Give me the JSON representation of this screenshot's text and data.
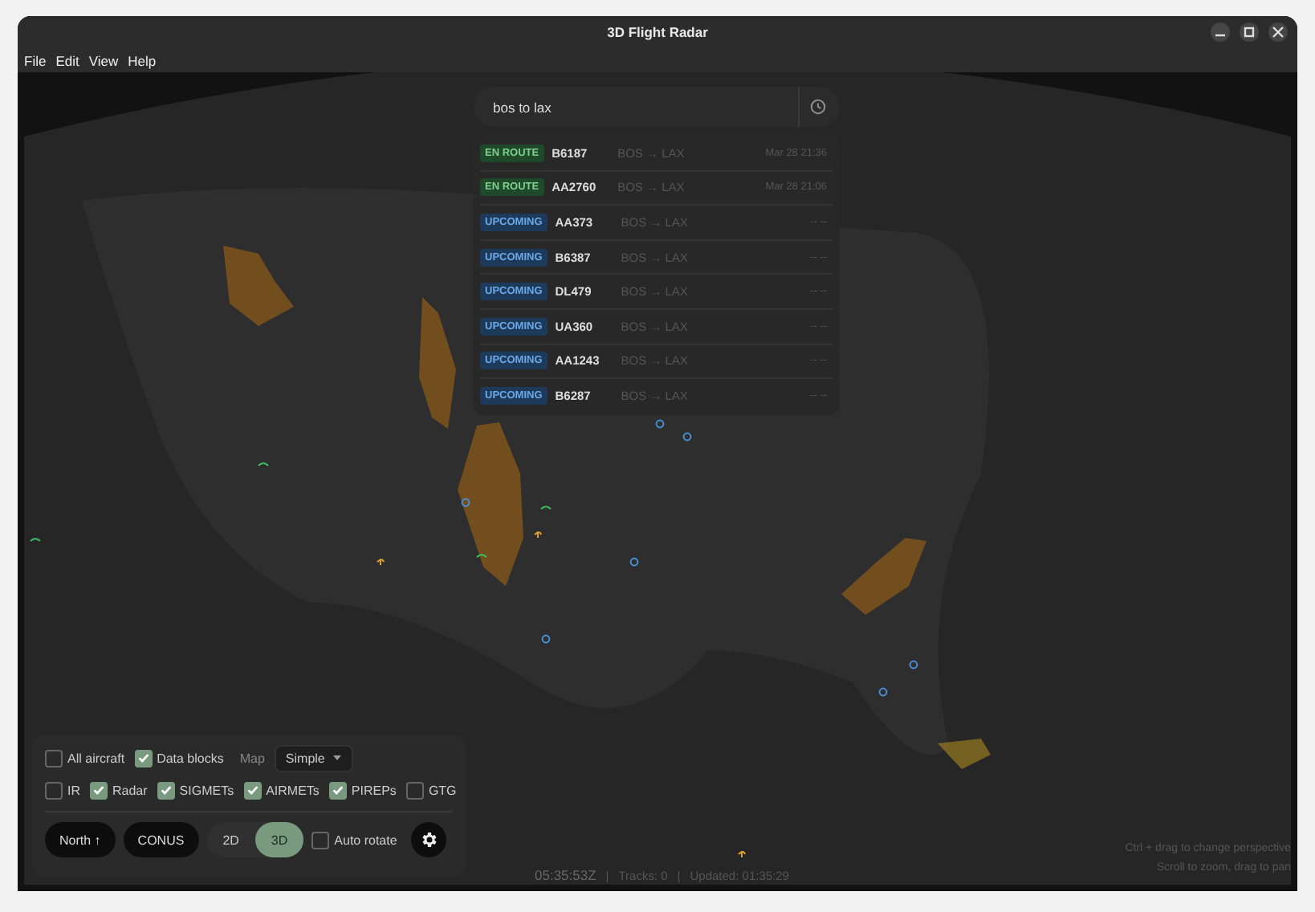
{
  "window": {
    "title": "3D Flight Radar"
  },
  "menu": [
    "File",
    "Edit",
    "View",
    "Help"
  ],
  "search": {
    "value": "bos to lax"
  },
  "results": [
    {
      "kind": "en_route",
      "status": "EN ROUTE",
      "flight": "B6187",
      "route": "BOS → LAX",
      "time": "Mar 28 21:36"
    },
    {
      "kind": "en_route",
      "status": "EN ROUTE",
      "flight": "AA2760",
      "route": "BOS → LAX",
      "time": "Mar 28 21:06"
    },
    {
      "kind": "upcoming",
      "status": "UPCOMING",
      "flight": "AA373",
      "route": "BOS → LAX",
      "time": "-- --"
    },
    {
      "kind": "upcoming",
      "status": "UPCOMING",
      "flight": "B6387",
      "route": "BOS → LAX",
      "time": "-- --"
    },
    {
      "kind": "upcoming",
      "status": "UPCOMING",
      "flight": "DL479",
      "route": "BOS → LAX",
      "time": "-- --"
    },
    {
      "kind": "upcoming",
      "status": "UPCOMING",
      "flight": "UA360",
      "route": "BOS → LAX",
      "time": "-- --"
    },
    {
      "kind": "upcoming",
      "status": "UPCOMING",
      "flight": "AA1243",
      "route": "BOS → LAX",
      "time": "-- --"
    },
    {
      "kind": "upcoming",
      "status": "UPCOMING",
      "flight": "B6287",
      "route": "BOS → LAX",
      "time": "-- --"
    }
  ],
  "controls": {
    "row_1": [
      {
        "label": "All aircraft",
        "checked": false
      },
      {
        "label": "Data blocks",
        "checked": true
      }
    ],
    "map_select": {
      "label": "Map",
      "value": "Simple"
    },
    "row_2": [
      {
        "label": "IR",
        "checked": false
      },
      {
        "label": "Radar",
        "checked": true
      },
      {
        "label": "SIGMETs",
        "checked": true
      },
      {
        "label": "AIRMETs",
        "checked": true
      },
      {
        "label": "PIREPs",
        "checked": true
      },
      {
        "label": "GTG",
        "checked": false
      }
    ],
    "buttons": [
      "North ↑",
      "CONUS"
    ],
    "view_modes": [
      {
        "label": "2D",
        "selected": false
      },
      {
        "label": "3D",
        "selected": true
      }
    ],
    "auto_rotate": {
      "label": "Auto rotate",
      "checked": false
    }
  },
  "status_bar": {
    "clock": "05:35:53Z",
    "tracks": "Tracks: 0",
    "updated": "Updated: 01:35:29",
    "separators": [
      "|",
      "|"
    ]
  },
  "hints": [
    "Ctrl + drag to change perspective",
    "Scroll to zoom, drag to pan"
  ]
}
